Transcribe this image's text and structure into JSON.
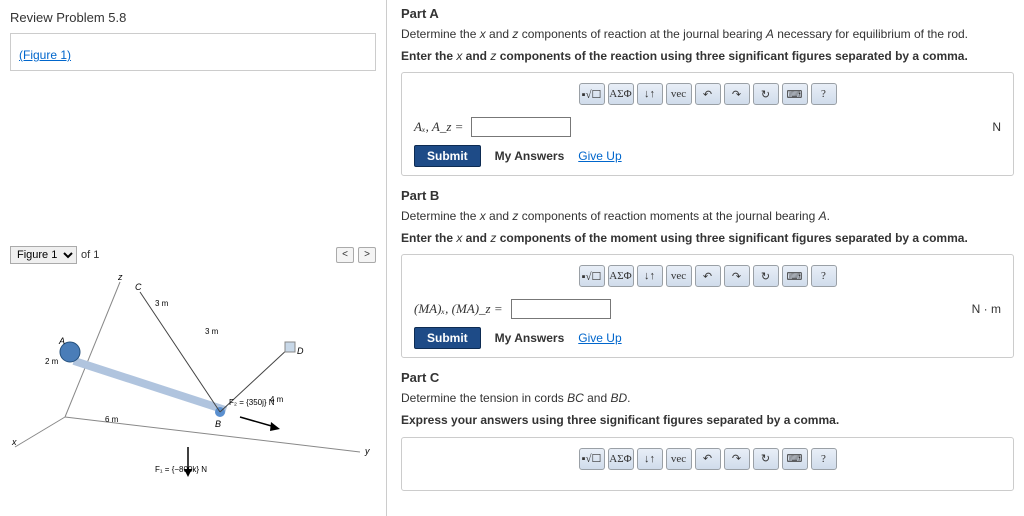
{
  "problem": {
    "title": "Review Problem 5.8"
  },
  "figure_link": "(Figure 1)",
  "figure_nav": {
    "select_value": "Figure 1",
    "of_label": "of 1",
    "prev": "<",
    "next": ">"
  },
  "diagram_labels": {
    "c": "C",
    "a": "A",
    "b": "B",
    "d": "D",
    "x": "x",
    "y": "y",
    "z": "z",
    "len_2m": "2 m",
    "len_3m_a": "3 m",
    "len_3m_b": "3 m",
    "len_4m": "4 m",
    "len_6m": "6 m",
    "f1": "F₁ = {−800k} N",
    "f2": "F₂ = {350j} N"
  },
  "partA": {
    "header": "Part A",
    "prompt_pre": "Determine the ",
    "prompt_x": "x",
    "prompt_mid": " and ",
    "prompt_z": "z",
    "prompt_post": " components of reaction at the journal bearing ",
    "prompt_A": "A",
    "prompt_end": " necessary for equilibrium of the rod.",
    "hint_pre": "Enter the ",
    "hint_x": "x",
    "hint_mid": " and ",
    "hint_z": "z",
    "hint_post": " components of the reaction using three significant figures separated by a comma.",
    "var_label": "Aₓ, A_z =",
    "unit": "N"
  },
  "partB": {
    "header": "Part B",
    "prompt_pre": "Determine the ",
    "prompt_x": "x",
    "prompt_mid": " and ",
    "prompt_z": "z",
    "prompt_post": " components of reaction moments at the journal bearing ",
    "prompt_A": "A",
    "prompt_end": ".",
    "hint_pre": "Enter the ",
    "hint_x": "x",
    "hint_mid": " and ",
    "hint_z": "z",
    "hint_post": " components of the moment using three significant figures separated by a comma.",
    "var_label": "(MA)ₓ, (MA)_z =",
    "unit": "N · m"
  },
  "partC": {
    "header": "Part C",
    "prompt_pre": "Determine the tension in cords ",
    "prompt_bc": "BC",
    "prompt_mid2": " and ",
    "prompt_bd": "BD",
    "prompt_end": ".",
    "hint": "Express your answers using three significant figures separated by a comma."
  },
  "toolbar": {
    "templates": "▪√☐",
    "greek": "ΑΣΦ",
    "arrows": "↓↑",
    "vec": "vec",
    "undo": "↶",
    "redo": "↷",
    "reset": "↻",
    "keyboard": "⌨",
    "help": "?"
  },
  "controls": {
    "submit": "Submit",
    "my_answers": "My Answers",
    "give_up": "Give Up"
  }
}
